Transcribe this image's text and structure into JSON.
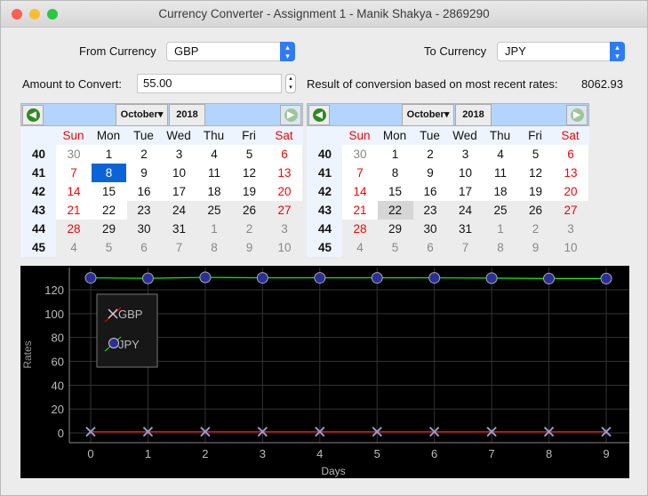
{
  "window": {
    "title": "Currency Converter - Assignment 1 - Manik Shakya - 2869290"
  },
  "from": {
    "label": "From Currency",
    "value": "GBP"
  },
  "to": {
    "label": "To Currency",
    "value": "JPY"
  },
  "amount": {
    "label": "Amount to Convert:",
    "value": "55.00"
  },
  "result": {
    "label": "Result of conversion based on most recent rates:",
    "value": "8062.93"
  },
  "calendar_left": {
    "month": "October",
    "year": "2018",
    "selected": 8,
    "today": 22,
    "day_headers": [
      "Sun",
      "Mon",
      "Tue",
      "Wed",
      "Thu",
      "Fri",
      "Sat"
    ],
    "weeks": [
      "40",
      "41",
      "42",
      "43",
      "44",
      "45"
    ],
    "days": [
      [
        30,
        1,
        2,
        3,
        4,
        5,
        6
      ],
      [
        7,
        8,
        9,
        10,
        11,
        12,
        13
      ],
      [
        14,
        15,
        16,
        17,
        18,
        19,
        20
      ],
      [
        21,
        22,
        23,
        24,
        25,
        26,
        27
      ],
      [
        28,
        29,
        30,
        31,
        1,
        2,
        3
      ],
      [
        4,
        5,
        6,
        7,
        8,
        9,
        10
      ]
    ]
  },
  "calendar_right": {
    "month": "October",
    "year": "2018",
    "selected": 22,
    "today": 22,
    "day_headers": [
      "Sun",
      "Mon",
      "Tue",
      "Wed",
      "Thu",
      "Fri",
      "Sat"
    ],
    "weeks": [
      "40",
      "41",
      "42",
      "43",
      "44",
      "45"
    ],
    "days": [
      [
        30,
        1,
        2,
        3,
        4,
        5,
        6
      ],
      [
        7,
        8,
        9,
        10,
        11,
        12,
        13
      ],
      [
        14,
        15,
        16,
        17,
        18,
        19,
        20
      ],
      [
        21,
        22,
        23,
        24,
        25,
        26,
        27
      ],
      [
        28,
        29,
        30,
        31,
        1,
        2,
        3
      ],
      [
        4,
        5,
        6,
        7,
        8,
        9,
        10
      ]
    ]
  },
  "colors": {
    "accent": "#0a64d8",
    "weekend": "#ff0000",
    "gbp_line": "#ff0000",
    "jpy_line": "#00ff00",
    "jpy_marker": "#2c2f9a"
  },
  "chart_data": {
    "type": "line",
    "xlabel": "Days",
    "ylabel": "Rates",
    "x": [
      0,
      1,
      2,
      3,
      4,
      5,
      6,
      7,
      8,
      9
    ],
    "xlim": [
      -0.4,
      9.4
    ],
    "ylim": [
      -8,
      138
    ],
    "yticks": [
      0,
      20,
      40,
      60,
      80,
      100,
      120
    ],
    "grid": true,
    "legend": "top-left",
    "series": [
      {
        "name": "GBP",
        "marker": "x",
        "values": [
          1,
          1,
          1,
          1,
          1,
          1,
          1,
          1,
          1,
          1
        ]
      },
      {
        "name": "JPY",
        "marker": "circle",
        "values": [
          130.0,
          129.6,
          130.4,
          130.0,
          130.0,
          130.0,
          130.0,
          129.8,
          129.4,
          129.4
        ]
      }
    ]
  }
}
